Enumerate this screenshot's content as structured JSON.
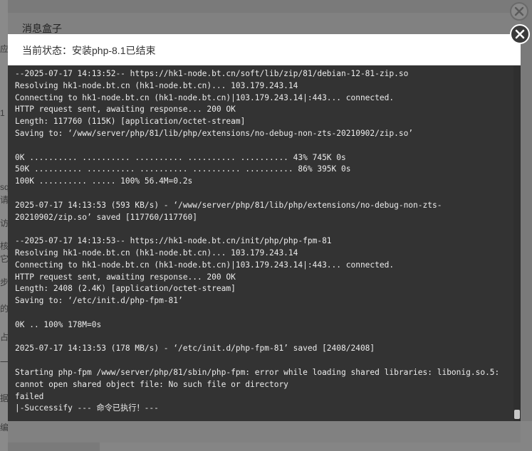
{
  "outer_box": {
    "title": "消息盒子"
  },
  "dialog": {
    "title": "当前状态：安装php-8.1已结束"
  },
  "background_fragments": [
    "应",
    "1",
    "sq",
    "请",
    "访",
    "核",
    "它",
    "步",
    "的",
    "占",
    "一",
    "据",
    "编"
  ],
  "terminal": {
    "lines": [
      "--2025-07-17 14:13:52-- https://hk1-node.bt.cn/soft/lib/zip/81/debian-12-81-zip.so",
      "Resolving hk1-node.bt.cn (hk1-node.bt.cn)... 103.179.243.14",
      "Connecting to hk1-node.bt.cn (hk1-node.bt.cn)|103.179.243.14|:443... connected.",
      "HTTP request sent, awaiting response... 200 OK",
      "Length: 117760 (115K) [application/octet-stream]",
      "Saving to: ‘/www/server/php/81/lib/php/extensions/no-debug-non-zts-20210902/zip.so’",
      "",
      "0K .......... .......... .......... .......... .......... 43% 745K 0s",
      "50K .......... .......... .......... .......... .......... 86% 395K 0s",
      "100K .......... ..... 100% 56.4M=0.2s",
      "",
      "2025-07-17 14:13:53 (593 KB/s) - ‘/www/server/php/81/lib/php/extensions/no-debug-non-zts-",
      "20210902/zip.so’ saved [117760/117760]",
      "",
      "--2025-07-17 14:13:53-- https://hk1-node.bt.cn/init/php/php-fpm-81",
      "Resolving hk1-node.bt.cn (hk1-node.bt.cn)... 103.179.243.14",
      "Connecting to hk1-node.bt.cn (hk1-node.bt.cn)|103.179.243.14|:443... connected.",
      "HTTP request sent, awaiting response... 200 OK",
      "Length: 2408 (2.4K) [application/octet-stream]",
      "Saving to: ‘/etc/init.d/php-fpm-81’",
      "",
      "0K .. 100% 178M=0s",
      "",
      "2025-07-17 14:13:53 (178 MB/s) - ‘/etc/init.d/php-fpm-81’ saved [2408/2408]",
      "",
      "Starting php-fpm /www/server/php/81/sbin/php-fpm: error while loading shared libraries: libonig.so.5:",
      "cannot open shared object file: No such file or directory",
      "failed",
      "|-Successify --- 命令已执行！---"
    ]
  },
  "icons": {
    "outer_close": "close-circle-icon",
    "dialog_close": "close-circle-icon"
  },
  "colors": {
    "terminal_bg": "#333333",
    "terminal_text": "#ececec",
    "close_button": "#3a3a3a"
  }
}
